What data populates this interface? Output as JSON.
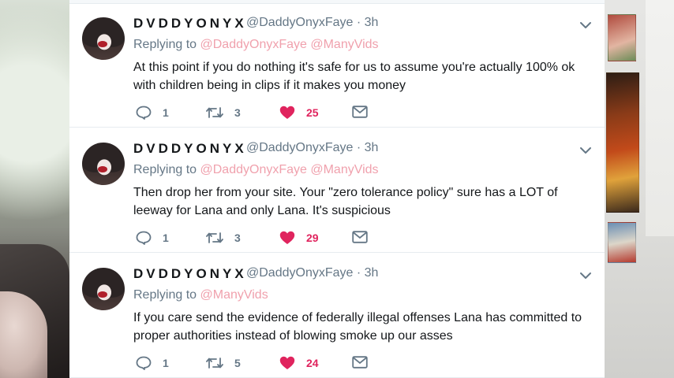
{
  "tweets": [
    {
      "name": "DVDDYONYX",
      "handle": "@DaddyOnyxFaye · 3h",
      "replying_prefix": "Replying to ",
      "mentions": "@DaddyOnyxFaye @ManyVids",
      "line1": "At this point if you do nothing it's safe for us to assume you're actually 100% ok",
      "line2": "with children being in clips if it makes you money",
      "replies": "1",
      "retweets": "3",
      "likes": "25"
    },
    {
      "name": "DVDDYONYX",
      "handle": "@DaddyOnyxFaye · 3h",
      "replying_prefix": "Replying to ",
      "mentions": "@DaddyOnyxFaye @ManyVids",
      "line1": "Then drop her from your site. Your \"zero tolerance policy\" sure has a LOT of",
      "line2": "leeway for Lana and only Lana. It's suspicious",
      "replies": "1",
      "retweets": "3",
      "likes": "29"
    },
    {
      "name": "DVDDYONYX",
      "handle": "@DaddyOnyxFaye · 3h",
      "replying_prefix": "Replying to ",
      "mentions": "@ManyVids",
      "line1": "If you care send the evidence of federally illegal offenses Lana has committed to",
      "line2": "proper authorities instead of blowing smoke up our asses",
      "replies": "1",
      "retweets": "5",
      "likes": "24"
    }
  ],
  "colors": {
    "like": "#e0245e",
    "mention": "#f0a1ad",
    "muted": "#657786",
    "text": "#14171a"
  },
  "icons": [
    "reply-icon",
    "retweet-icon",
    "heart-icon",
    "mail-icon",
    "chevron-down-icon"
  ]
}
